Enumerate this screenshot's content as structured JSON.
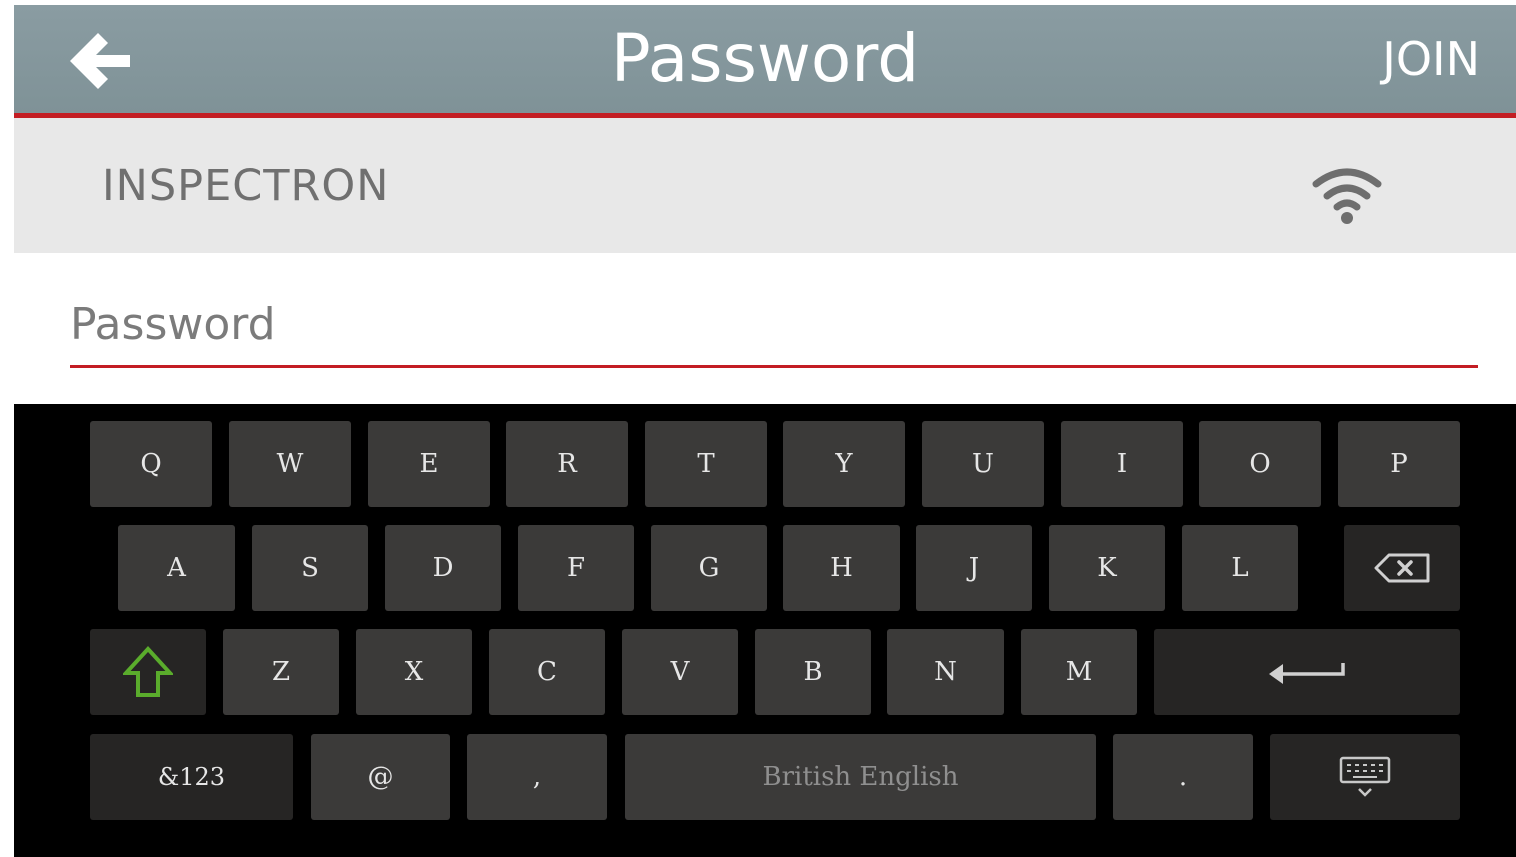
{
  "header": {
    "title": "Password",
    "join_label": "JOIN"
  },
  "network": {
    "name": "INSPECTRON"
  },
  "password_field": {
    "placeholder": "Password",
    "value": ""
  },
  "keyboard": {
    "row1": [
      "Q",
      "W",
      "E",
      "R",
      "T",
      "Y",
      "U",
      "I",
      "O",
      "P"
    ],
    "row2": [
      "A",
      "S",
      "D",
      "F",
      "G",
      "H",
      "J",
      "K",
      "L"
    ],
    "row3": [
      "Z",
      "X",
      "C",
      "V",
      "B",
      "N",
      "M"
    ],
    "row4": {
      "symbols": "&123",
      "at": "@",
      "comma": ",",
      "space": "British English",
      "period": "."
    }
  },
  "colors": {
    "accent": "#c31d23",
    "header_bg": "#849699",
    "shift_icon": "#5aac2c",
    "key_bg": "#3b3a39",
    "key_dark_bg": "#262524"
  }
}
